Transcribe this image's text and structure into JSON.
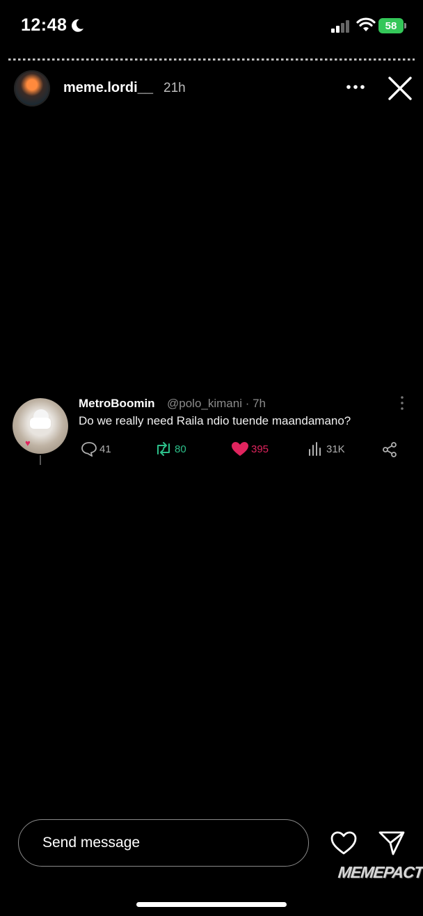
{
  "status_bar": {
    "time": "12:48",
    "battery": "58"
  },
  "story": {
    "username": "meme.lordi__",
    "time_ago": "21h"
  },
  "tweet": {
    "name": "MetroBoomin",
    "handle_time": "@polo_kimani · 7h",
    "text": "Do we really need Raila ndio tuende maandamano?",
    "replies": "41",
    "retweets": "80",
    "likes": "395",
    "views": "31K",
    "colors": {
      "retweet": "#2cc08a",
      "like": "#e0245e"
    }
  },
  "bottom": {
    "input_placeholder": "Send message",
    "watermark": "MEMEPACT"
  },
  "icons": [
    "moon-icon",
    "signal-icon",
    "wifi-icon",
    "battery-icon",
    "more-icon",
    "close-icon",
    "reply-icon",
    "retweet-icon",
    "like-icon",
    "views-icon",
    "share-icon",
    "heart-icon",
    "send-icon"
  ]
}
